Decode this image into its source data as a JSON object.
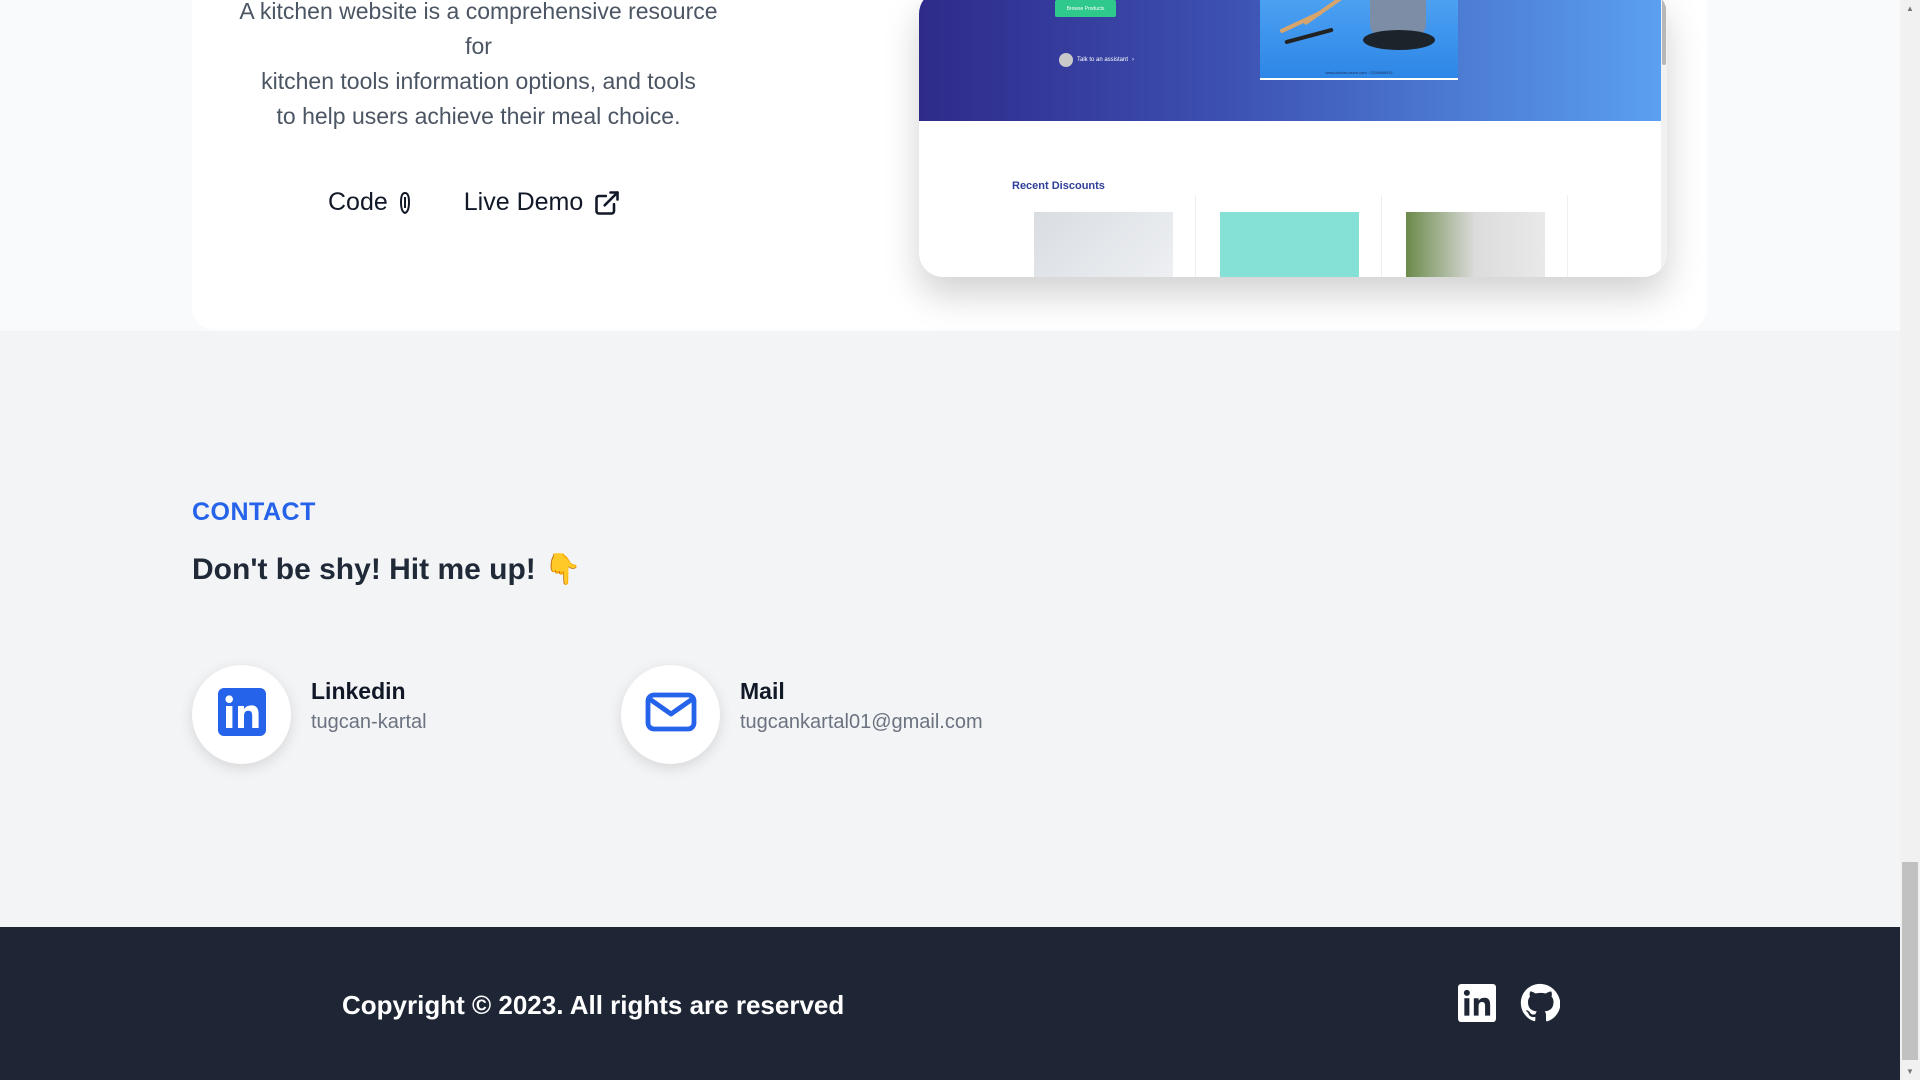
{
  "project": {
    "description_lines": [
      "A kitchen website is a comprehensive resource",
      "for",
      "kitchen tools information options, and tools",
      "to help users achieve their meal choice."
    ],
    "code_label": "Code",
    "demo_label": "Live Demo",
    "preview": {
      "browse_label": "Browse Products",
      "assistant_label": "Talk to an assistant",
      "hero_caption": "www.kitchen-store.com · 2204088913",
      "recent_title": "Recent Discounts"
    }
  },
  "contact": {
    "section_label": "CONTACT",
    "title": "Don't be shy! Hit me up! 👇",
    "items": [
      {
        "name": "Linkedin",
        "value": "tugcan-kartal",
        "icon": "linkedin-icon"
      },
      {
        "name": "Mail",
        "value": "tugcankartal01@gmail.com",
        "icon": "mail-icon"
      }
    ]
  },
  "footer": {
    "copyright": "Copyright © 2023. All rights are reserved",
    "icons": [
      "linkedin-icon",
      "github-icon"
    ]
  },
  "colors": {
    "accent": "#2563eb",
    "footer_bg": "#1e2635",
    "page_bg": "#f3f4f6"
  }
}
